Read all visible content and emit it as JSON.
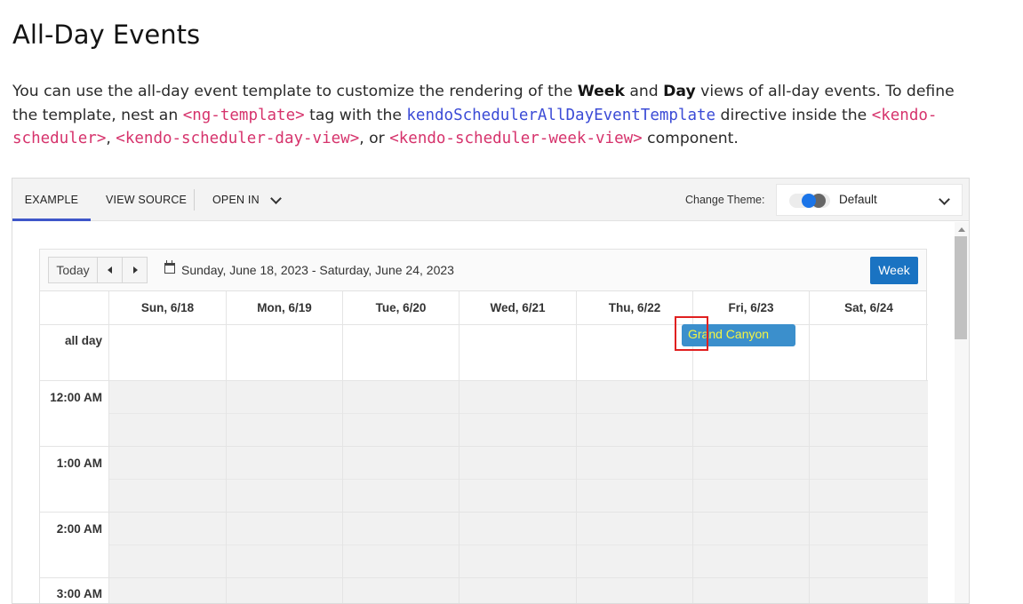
{
  "page": {
    "title": "All-Day Events",
    "intro": {
      "t1": "You can use the all-day event template to customize the rendering of the ",
      "b1": "Week",
      "t2": " and ",
      "b2": "Day",
      "t3": " views of all-day events. To define the template, nest an ",
      "c1": "<ng-template>",
      "t4": " tag with the ",
      "c2": "kendoSchedulerAllDayEventTemplate",
      "t5": " directive inside the ",
      "c3": "<kendo-scheduler>",
      "t6": ", ",
      "c4": "<kendo-scheduler-day-view>",
      "t7": ", or ",
      "c5": "<kendo-scheduler-week-view>",
      "t8": " component."
    }
  },
  "demo_toolbar": {
    "tabs": [
      "EXAMPLE",
      "VIEW SOURCE",
      "OPEN IN"
    ],
    "theme_label": "Change Theme:",
    "theme_value": "Default"
  },
  "scheduler": {
    "today_label": "Today",
    "date_range": "Sunday, June 18, 2023 - Saturday, June 24, 2023",
    "view_label": "Week",
    "days": [
      "Sun, 6/18",
      "Mon, 6/19",
      "Tue, 6/20",
      "Wed, 6/21",
      "Thu, 6/22",
      "Fri, 6/23",
      "Sat, 6/24"
    ],
    "allday_label": "all day",
    "times": [
      "12:00 AM",
      "1:00 AM",
      "2:00 AM",
      "3:00 AM"
    ],
    "event": {
      "title": "Grand Canyon",
      "day": "Fri, 6/23"
    }
  },
  "colors": {
    "accent": "#3e56c9",
    "week_button": "#1a73c2",
    "event_bg": "#3b8fcc",
    "event_text": "#f5f542",
    "highlight": "#e02020",
    "code_pink": "#d6336c",
    "code_blue": "#3b4bd6"
  }
}
